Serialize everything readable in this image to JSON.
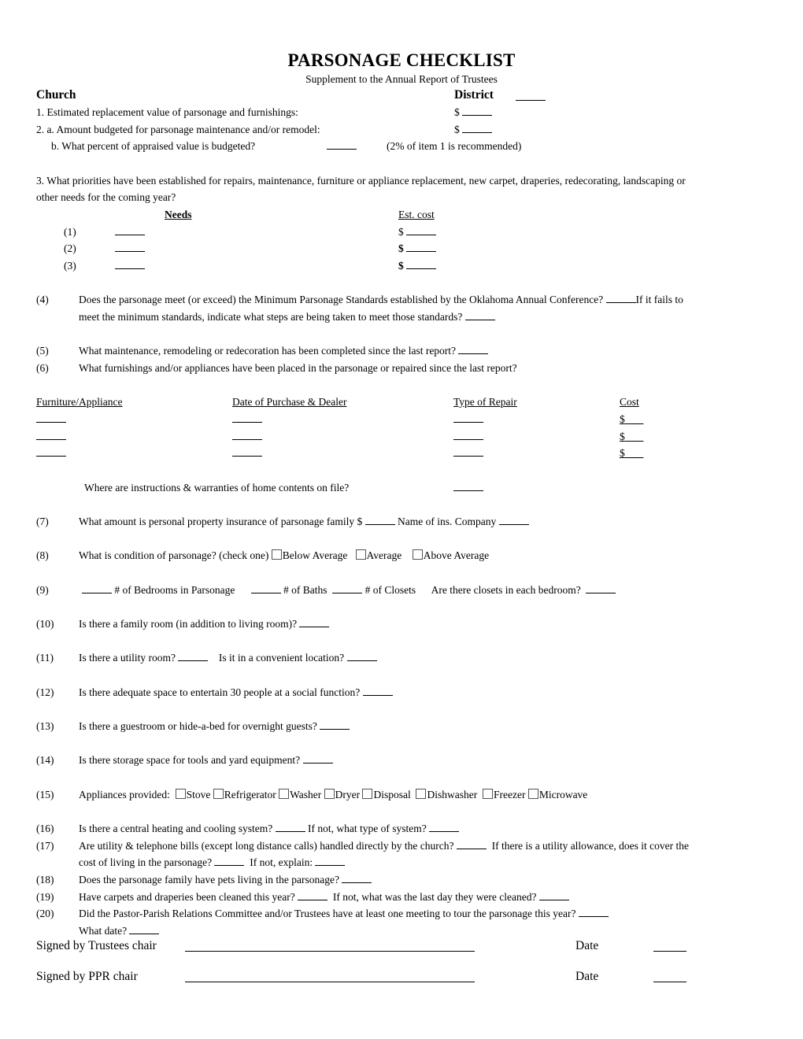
{
  "header": {
    "title": "PARSONAGE CHECKLIST",
    "subtitle": "Supplement to the Annual Report of Trustees",
    "church_label": "Church",
    "district_label": "District"
  },
  "items": {
    "q1": "1.  Estimated replacement value of parsonage and furnishings:",
    "q2a": "2.  a. Amount budgeted for parsonage maintenance and/or remodel:",
    "q2b": "b. What percent of appraised value is budgeted?",
    "q2b_note": "(2% of item 1 is recommended)",
    "currency": "$",
    "q3_line1": "3.  What priorities have been established for repairs, maintenance, furniture or appliance replacement, new carpet, draperies, redecorating, landscaping or",
    "q3_line2": "other needs for the coming year?",
    "needs_header": "Needs",
    "est_cost_header": "Est. cost",
    "needs_rows": [
      "(1)",
      "(2)",
      "(3)"
    ],
    "q4_num": "(4)",
    "q4_line1a": "Does the parsonage meet (or exceed) the Minimum Parsonage Standards established by the Oklahoma Annual Conference?",
    "q4_line1b": "If it fails to",
    "q4_line2": "meet the minimum standards, indicate what steps are being taken to meet those standards?",
    "q5_num": "(5)",
    "q5": "What maintenance, remodeling or redecoration has been completed since the last report?",
    "q6_num": "(6)",
    "q6": "What furnishings and/or appliances have been placed in the parsonage or repaired since the last report?",
    "table_headers": [
      "Furniture/Appliance",
      "Date of Purchase & Dealer",
      "Type of Repair",
      "Cost"
    ],
    "warranties": "Where are instructions & warranties of home contents on file?",
    "q7_num": "(7)",
    "q7a": "What amount is personal property insurance of parsonage family  $",
    "q7b": "Name of ins. Company",
    "q8_num": "(8)",
    "q8": "What is condition of parsonage? (check one)",
    "q8_options": [
      "Below Average",
      "Average",
      "Above Average"
    ],
    "q9_num": "(9)",
    "q9a": "# of Bedrooms in Parsonage",
    "q9b": "# of Baths",
    "q9c": "# of Closets",
    "q9d": "Are there closets in each bedroom?",
    "q10_num": "(10)",
    "q10": "Is there a family room (in addition to living room)?",
    "q11_num": "(11)",
    "q11a": "Is there a utility room?",
    "q11b": "Is it in a convenient location?",
    "q12_num": "(12)",
    "q12": "Is there adequate space to entertain 30 people at a social function?",
    "q13_num": "(13)",
    "q13": "Is there a guestroom or hide-a-bed for overnight guests?",
    "q14_num": "(14)",
    "q14": "Is there storage space for tools and yard equipment?",
    "q15_num": "(15)",
    "q15": "Appliances provided:",
    "q15_options": [
      "Stove",
      "Refrigerator",
      "Washer",
      "Dryer",
      "Disposal",
      "Dishwasher",
      "Freezer",
      "Microwave"
    ],
    "q16_num": "(16)",
    "q16a": "Is there a central heating and cooling system?",
    "q16b": "If not, what type of system?",
    "q17_num": "(17)",
    "q17a": "Are utility & telephone bills (except long distance calls) handled directly by the church?",
    "q17b": "If there is a utility allowance, does it cover the",
    "q17c": "cost of living in the parsonage?",
    "q17d": "If not, explain:",
    "q18_num": "(18)",
    "q18": "Does the parsonage family have pets living in the parsonage?",
    "q19_num": "(19)",
    "q19a": "Have carpets and draperies been cleaned this year?",
    "q19b": "If not, what was the last day they were cleaned?",
    "q20_num": "(20)",
    "q20a": "Did the Pastor-Parish Relations Committee and/or Trustees have at least one meeting to tour the parsonage this year?",
    "q20b": "What date?"
  },
  "signatures": {
    "trustees_label": "Signed by Trustees chair",
    "ppr_label": "Signed by PPR chair",
    "date_label": "Date"
  }
}
